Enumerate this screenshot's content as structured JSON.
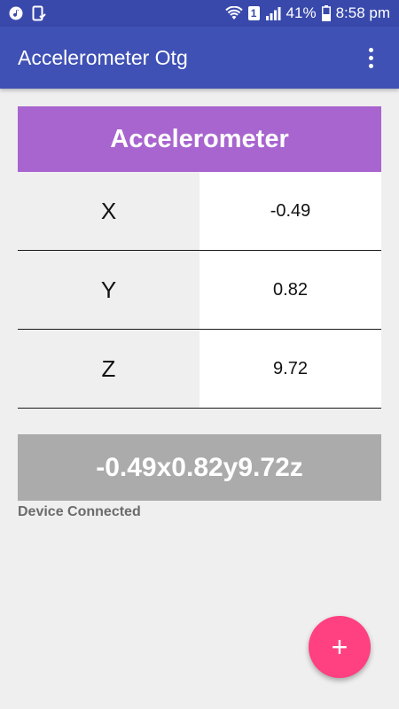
{
  "status_bar": {
    "battery_percent": "41%",
    "time": "8:58 pm",
    "sim_label": "1",
    "left_icons": [
      "music-note-icon",
      "notification-icon"
    ],
    "right_icons": [
      "wifi-icon",
      "sim-icon",
      "signal-icon",
      "battery-icon"
    ]
  },
  "app_bar": {
    "title": "Accelerometer Otg",
    "menu_icon": "overflow-menu-icon"
  },
  "panel": {
    "title": "Accelerometer",
    "rows": [
      {
        "axis": "X",
        "value": "-0.49"
      },
      {
        "axis": "Y",
        "value": "0.82"
      },
      {
        "axis": "Z",
        "value": "9.72"
      }
    ]
  },
  "combined_reading": "-0.49x0.82y9.72z",
  "connection_status": "Device Connected",
  "fab": {
    "label": "+",
    "icon": "plus-icon"
  },
  "colors": {
    "status_bar": "#3949ab",
    "app_bar": "#3f51b5",
    "panel_header": "#a864cf",
    "combined_bg": "#ababab",
    "fab": "#ff4081",
    "background": "#efefef"
  }
}
